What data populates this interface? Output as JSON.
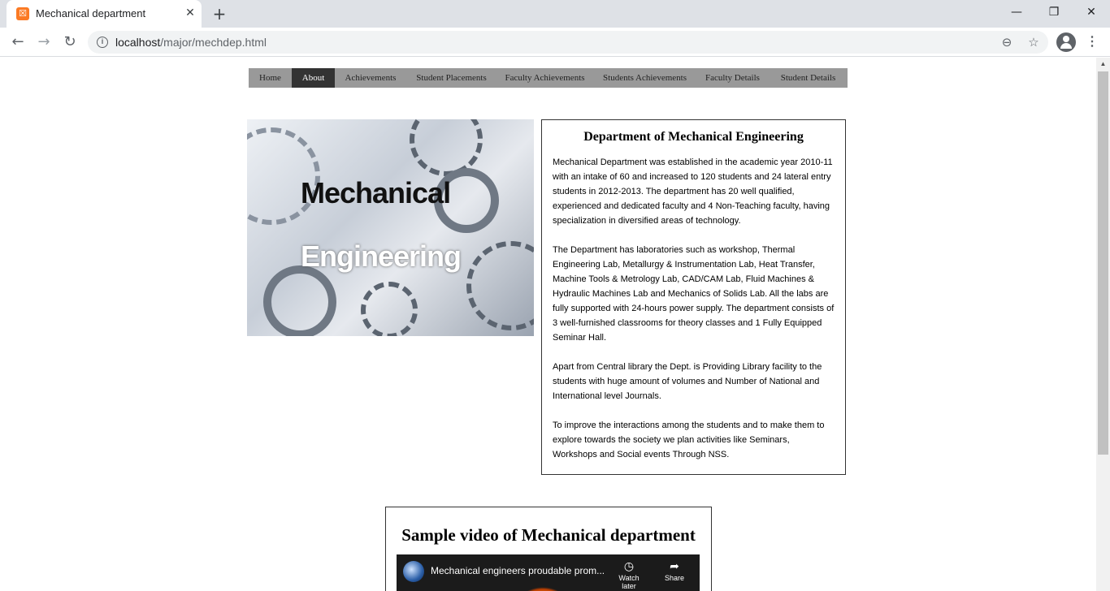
{
  "browser": {
    "tab_title": "Mechanical department",
    "favicon_glyph": "☒",
    "close_glyph": "✕",
    "newtab_glyph": "+",
    "url_host": "localhost",
    "url_path": "/major/mechdep.html",
    "window_buttons": {
      "minimize": "—",
      "maximize": "❐",
      "close": "✕"
    },
    "nav": {
      "back": "←",
      "forward": "→",
      "reload": "↻"
    },
    "icons": {
      "zoom": "⊖",
      "star": "☆",
      "menu": "⋮"
    }
  },
  "site_nav": {
    "items": [
      {
        "label": "Home",
        "active": false
      },
      {
        "label": "About",
        "active": true
      },
      {
        "label": "Achievements",
        "active": false
      },
      {
        "label": "Student Placements",
        "active": false
      },
      {
        "label": "Faculty Achievements",
        "active": false
      },
      {
        "label": "Students Achievements",
        "active": false
      },
      {
        "label": "Faculty Details",
        "active": false
      },
      {
        "label": "Student Details",
        "active": false
      }
    ]
  },
  "hero": {
    "line1": "Mechanical",
    "line2": "Engineering"
  },
  "info": {
    "title": "Department of Mechanical Engineering",
    "paragraphs": [
      "Mechanical Department was established in the academic year 2010-11 with an intake of 60 and increased to 120 students and 24 lateral entry students in 2012-2013. The department has 20 well qualified, experienced and dedicated faculty and 4 Non-Teaching faculty, having specialization in diversified areas of technology.",
      "The Department has laboratories such as workshop, Thermal Engineering Lab, Metallurgy & Instrumentation Lab, Heat Transfer, Machine Tools & Metrology Lab, CAD/CAM Lab, Fluid Machines & Hydraulic Machines Lab and Mechanics of Solids Lab. All the labs are fully supported with 24-hours power supply. The department consists of 3 well-furnished classrooms for theory classes and 1 Fully Equipped Seminar Hall.",
      "Apart from Central library the Dept. is Providing Library facility to the students with huge amount of volumes and Number of National and International level Journals.",
      "To improve the interactions among the students and to make them to explore towards the society we plan activities like Seminars, Workshops and Social events Through NSS."
    ]
  },
  "video": {
    "heading": "Sample video of Mechanical department",
    "title": "Mechanical engineers proudable prom...",
    "watch_later": "Watch later",
    "share": "Share",
    "watch_later_icon": "◷",
    "share_icon": "➦"
  }
}
